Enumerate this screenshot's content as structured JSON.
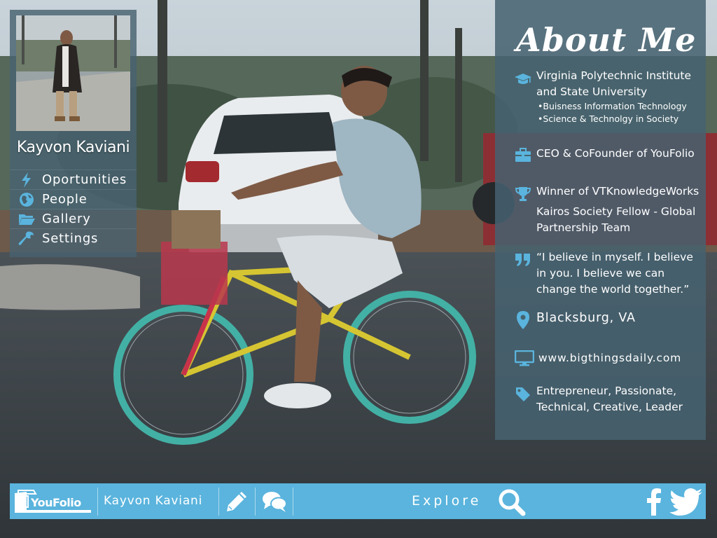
{
  "profile": {
    "name": "Kayvon Kaviani"
  },
  "nav": {
    "items": [
      {
        "label": "Oportunities",
        "icon": "lightning-icon"
      },
      {
        "label": "People",
        "icon": "globe-icon"
      },
      {
        "label": "Gallery",
        "icon": "folder-icon"
      },
      {
        "label": "Settings",
        "icon": "wrench-icon"
      }
    ]
  },
  "about": {
    "title": "About Me",
    "education": {
      "icon": "graduation-cap-icon",
      "line1": "Virginia Polytechnic Institute",
      "line2": "and State University",
      "sub1": "•Buisness Information Technology",
      "sub2": "•Science & Technolgy in Society"
    },
    "role": {
      "icon": "briefcase-icon",
      "text": "CEO & CoFounder of YouFolio"
    },
    "awards": {
      "icon": "trophy-icon",
      "line1": "Winner of VTKnowledgeWorks",
      "line2": "Kairos Society Fellow - Global",
      "line3": "Partnership Team"
    },
    "quote": {
      "icon": "quote-icon",
      "line1": "“I believe in myself. I believe",
      "line2": "in you. I believe we can",
      "line3": "change the world together.”"
    },
    "location": {
      "icon": "map-pin-icon",
      "text": "Blacksburg, VA"
    },
    "website": {
      "icon": "monitor-icon",
      "text": "www.bigthingsdaily.com"
    },
    "tags": {
      "icon": "tag-icon",
      "line1": "Entrepreneur,  Passionate,",
      "line2": "Technical, Creative, Leader"
    }
  },
  "bottom_bar": {
    "logo_text": "YouFolio",
    "user_name": "Kayvon Kaviani",
    "explore_label": "Explore"
  },
  "colors": {
    "accent": "#5ab4dd",
    "card_bg": "#46626f"
  }
}
